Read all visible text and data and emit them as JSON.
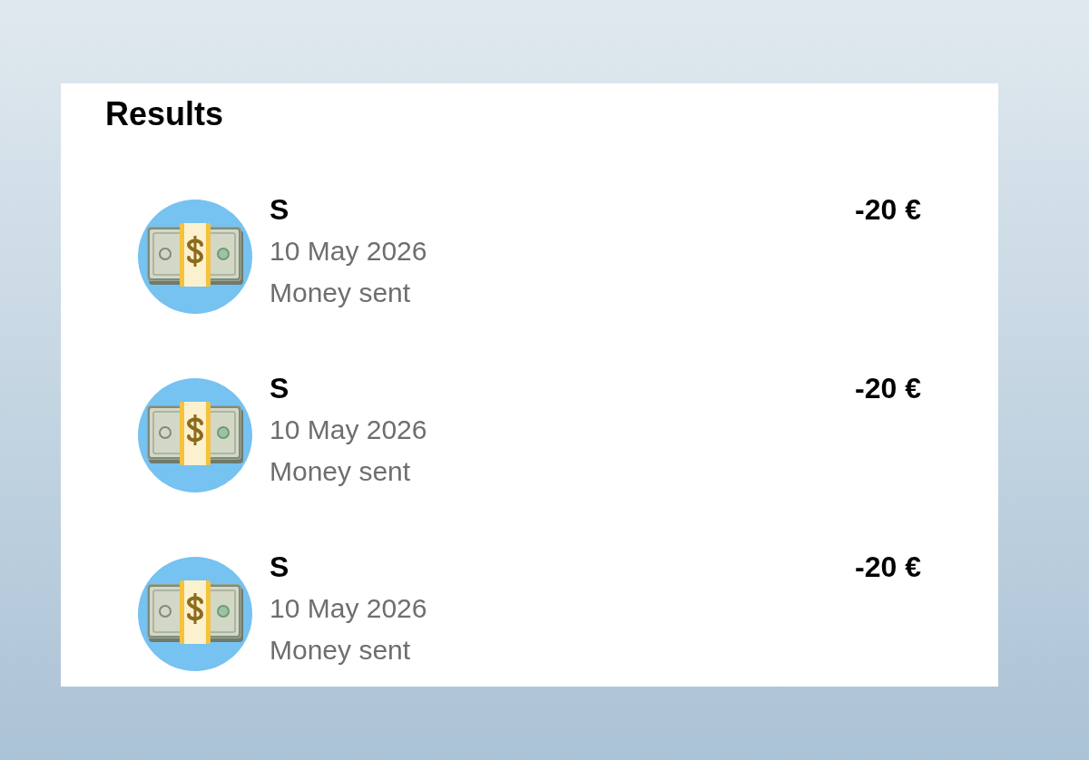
{
  "title": "Results",
  "transactions": [
    {
      "name": "S",
      "date": "10 May 2026",
      "description": "Money sent",
      "amount": "-20 €"
    },
    {
      "name": "S",
      "date": "10 May 2026",
      "description": "Money sent",
      "amount": "-20 €"
    },
    {
      "name": "S",
      "date": "10 May 2026",
      "description": "Money sent",
      "amount": "-20 €"
    }
  ]
}
